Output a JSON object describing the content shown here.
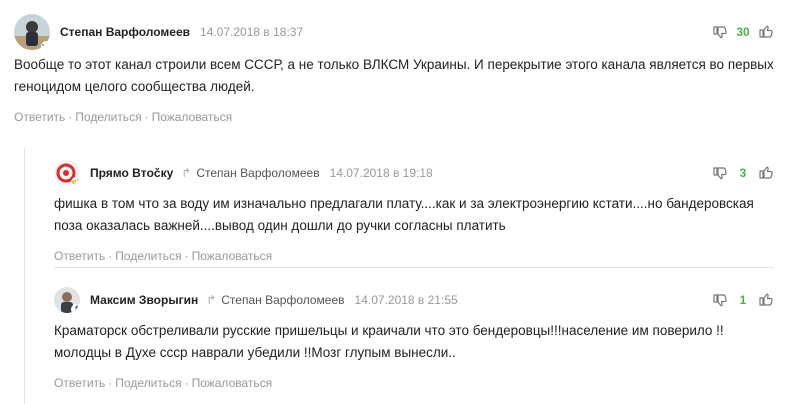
{
  "comments": [
    {
      "author": "Степан Варфоломеев",
      "date": "14.07.2018 в 18:37",
      "text": "Вообще то этот канал строили всем СССР, а не только ВЛКСМ Украины. И перекрытие этого канала является во первых геноцидом целого сообщества людей.",
      "score": "30",
      "network": "vk"
    },
    {
      "author": "Прямо Втočку",
      "reply_to": "Степан Варфоломеев",
      "date": "14.07.2018 в 19:18",
      "text": "фишка в том что за воду им изначально предлагали плату....как и за электроэнергию кстати....но бандеровская поза оказалась важней....вывод один дошли до ручки согласны платить",
      "score": "3",
      "network": "ok"
    },
    {
      "author": "Максим Зворыгин",
      "reply_to": "Степан Варфоломеев",
      "date": "14.07.2018 в 21:55",
      "text": "Краматорск обстреливали русские пришельцы и краичали что это бендеровцы!!!население им поверило !!молодцы в Духе ссср наврали убедили !!Мозг глупым вынесли..",
      "score": "1",
      "network": "fb"
    }
  ],
  "actions": {
    "reply": "Ответить",
    "share": "Поделиться",
    "report": "Пожаловаться",
    "separator": "·"
  },
  "icons": {
    "dislike": "thumbs-down-icon",
    "like": "thumbs-up-icon",
    "reply_arrow": "reply-arrow-icon"
  },
  "colors": {
    "score": "#4caf50",
    "muted": "#999999",
    "line": "#e3e3e3"
  }
}
